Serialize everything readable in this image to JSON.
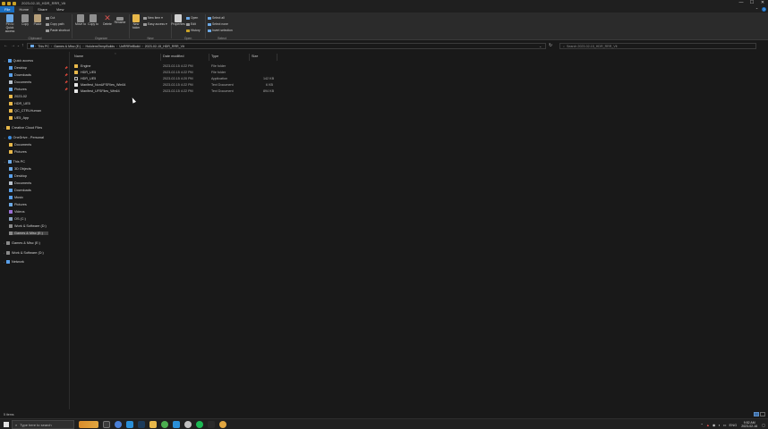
{
  "window": {
    "title": "2023-02-15_HDR_RRR_Vlt",
    "controls": [
      "—",
      "☐",
      "✕"
    ]
  },
  "tabs": [
    {
      "label": "File"
    },
    {
      "label": "Home"
    },
    {
      "label": "Share"
    },
    {
      "label": "View"
    }
  ],
  "ribbon": {
    "clipboard": {
      "label": "Clipboard",
      "pin": "Pin to Quick access",
      "copy": "Copy",
      "paste": "Paste",
      "cut": "Cut",
      "copy_path": "Copy path",
      "paste_shortcut": "Paste shortcut"
    },
    "organize": {
      "label": "Organize",
      "move_to": "Move to",
      "copy_to": "Copy to",
      "delete": "Delete",
      "rename": "Rename"
    },
    "new": {
      "label": "New",
      "new_folder": "New folder",
      "new_item": "New item",
      "easy_access": "Easy access"
    },
    "open": {
      "label": "Open",
      "properties": "Properties",
      "open": "Open",
      "edit": "Edit",
      "history": "History"
    },
    "select": {
      "label": "Select",
      "select_all": "Select all",
      "select_none": "Select none",
      "invert": "Invert selection"
    }
  },
  "address": {
    "crumbs": [
      "This PC",
      "Games & Misc (E:)",
      "HololensTempBuilds",
      "UnRRRelBuild",
      "2023-02-15_HDR_RRR_Vlt"
    ],
    "search_placeholder": "Search 2023-02-15_HDR_RRR_Vlt"
  },
  "navpane": {
    "quick_access": "Quick access",
    "quick_items": [
      "Desktop",
      "Downloads",
      "Documents",
      "Pictures",
      "2023-02",
      "HDR_UE5",
      "QC_CTRLHuman",
      "UE5_App"
    ],
    "creative_cloud": "Creative Cloud Files",
    "onedrive": "OneDrive - Personal",
    "onedrive_items": [
      "Documents",
      "Pictures"
    ],
    "this_pc": "This PC",
    "pc_items": [
      "3D Objects",
      "Desktop",
      "Documents",
      "Downloads",
      "Music",
      "Pictures",
      "Videos",
      "OS (C:)",
      "Work & Software (D:)",
      "Games & Misc (E:)"
    ],
    "drives": [
      "Games & Misc (E:)",
      "Work & Software (D:)"
    ],
    "network": "Network"
  },
  "columns": {
    "name": "Name",
    "date": "Date modified",
    "type": "Type",
    "size": "Size"
  },
  "files": [
    {
      "name": "Engine",
      "date": "2023-02-15 4:22 PM",
      "type": "File folder",
      "size": "",
      "icon": "folder"
    },
    {
      "name": "HDR_UE5",
      "date": "2023-02-15 4:22 PM",
      "type": "File folder",
      "size": "",
      "icon": "folder"
    },
    {
      "name": "HDR_UE5",
      "date": "2023-02-15 4:20 PM",
      "type": "Application",
      "size": "142 KB",
      "icon": "app"
    },
    {
      "name": "Manifest_NonUFSFiles_Win64",
      "date": "2023-02-15 4:22 PM",
      "type": "Text Document",
      "size": "6 KB",
      "icon": "text"
    },
    {
      "name": "Manifest_UFSFiles_Win64",
      "date": "2023-02-15 4:22 PM",
      "type": "Text Document",
      "size": "894 KB",
      "icon": "text"
    }
  ],
  "status": {
    "count": "5 items"
  },
  "taskbar": {
    "search_placeholder": "Type here to search",
    "lang": "ENG",
    "time": "9:52 AM",
    "date": "2023-02-16"
  },
  "colors": {
    "accent": "#1a6fc2",
    "folder": "#e8b84a",
    "background": "#191919",
    "ribbon": "#2b2b2b"
  }
}
